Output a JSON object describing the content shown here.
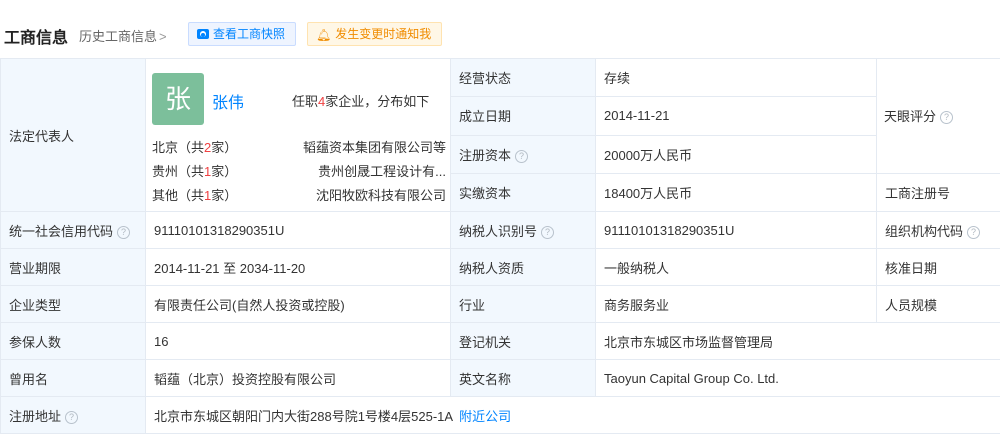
{
  "header": {
    "title": "工商信息",
    "history_label": "历史工商信息",
    "history_chevron": ">",
    "snapshot_label": "查看工商快照",
    "notify_label": "发生变更时通知我"
  },
  "legal_rep": {
    "label": "法定代表人",
    "avatar_char": "张",
    "name": "张伟",
    "holds_prefix": "任职",
    "holds_count": "4",
    "holds_suffix": "家企业，分布如下",
    "regions": [
      {
        "name_prefix": "北京（共",
        "count": "2",
        "name_suffix": "家）",
        "company": "韬蕴资本集团有限公司等"
      },
      {
        "name_prefix": "贵州（共",
        "count": "1",
        "name_suffix": "家）",
        "company": "贵州创晟工程设计有..."
      },
      {
        "name_prefix": "其他（共",
        "count": "1",
        "name_suffix": "家）",
        "company": "沈阳牧欧科技有限公司"
      }
    ]
  },
  "fields": {
    "status_label": "经营状态",
    "status_value": "存续",
    "founded_label": "成立日期",
    "founded_value": "2014-11-21",
    "reg_capital_label": "注册资本",
    "reg_capital_value": "20000万人民币",
    "paid_capital_label": "实缴资本",
    "paid_capital_value": "18400万人民币",
    "tianyan_label": "天眼评分",
    "reg_no_label": "工商注册号",
    "credit_code_label": "统一社会信用代码",
    "credit_code_value": "91110101318290351U",
    "taxpayer_id_label": "纳税人识别号",
    "taxpayer_id_value": "91110101318290351U",
    "org_code_label": "组织机构代码",
    "term_label": "营业期限",
    "term_value": "2014-11-21 至 2034-11-20",
    "taxpayer_type_label": "纳税人资质",
    "taxpayer_type_value": "一般纳税人",
    "approve_label": "核准日期",
    "company_type_label": "企业类型",
    "company_type_value": "有限责任公司(自然人投资或控股)",
    "industry_label": "行业",
    "industry_value": "商务服务业",
    "staff_label": "人员规模",
    "insured_label": "参保人数",
    "insured_value": "16",
    "registry_label": "登记机关",
    "registry_value": "北京市东城区市场监督管理局",
    "former_name_label": "曾用名",
    "former_name_value": "韬蕴（北京）投资控股有限公司",
    "english_label": "英文名称",
    "english_value": "Taoyun Capital Group Co. Ltd.",
    "address_label": "注册地址",
    "address_value": "北京市东城区朝阳门内大街288号院1号楼4层525-1A",
    "nearby_label": "附近公司"
  }
}
